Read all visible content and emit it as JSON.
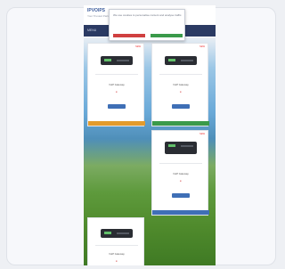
{
  "site": {
    "logo": "IPVOIPS",
    "tagline": "Your Trusted Partner",
    "nav": "MENU"
  },
  "cookie": {
    "text": "We use cookies to personalise content and analyse traffic.",
    "accept_label": "",
    "settings_label": ""
  },
  "products": [
    {
      "tag": "NEW",
      "name": "VoIP Gateway",
      "price": "£",
      "button": "",
      "bar_color": "#e39b2c"
    },
    {
      "tag": "NEW",
      "name": "VoIP Gateway",
      "price": "£",
      "button": "",
      "bar_color": "#3a9a4a"
    },
    {
      "tag": "NEW",
      "name": "VoIP Gateway",
      "price": "£",
      "button": "",
      "bar_color": "#3f6fb6"
    },
    {
      "tag": "",
      "name": "VoIP Gateway",
      "price": "£",
      "button": "",
      "bar_color": "#ffffff"
    }
  ],
  "colors": {
    "accent_red": "#d04040",
    "accent_green": "#3a9a4a",
    "nav_bg": "#2b3a63"
  }
}
